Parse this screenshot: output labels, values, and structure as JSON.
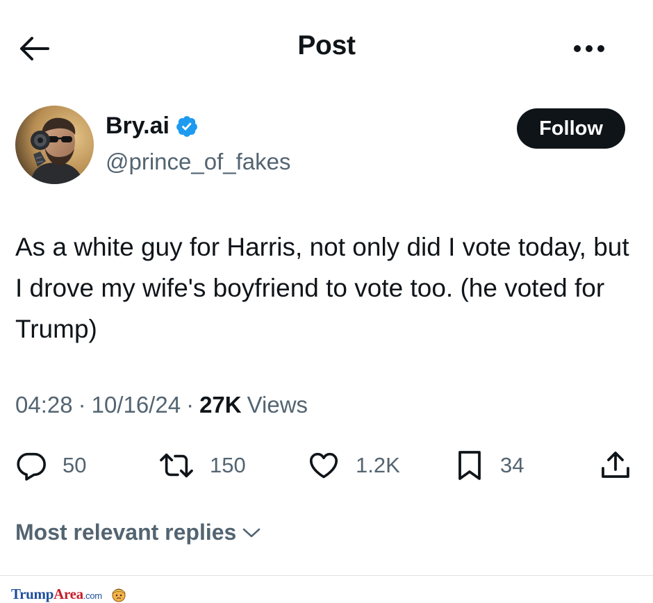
{
  "header": {
    "title": "Post",
    "back_icon": "arrow-left-icon",
    "more_icon": "more-horizontal-icon"
  },
  "author": {
    "display_name": "Bry.ai",
    "handle": "@prince_of_fakes",
    "verified_icon": "verified-badge-icon",
    "follow_label": "Follow"
  },
  "tweet": {
    "text": "As a white guy for Harris, not only did I vote today, but I drove my wife's boyfriend to vote too.  (he voted for Trump)"
  },
  "meta": {
    "time": "04:28",
    "separator": "·",
    "date": "10/16/24",
    "views_count": "27K",
    "views_label": "Views"
  },
  "actions": {
    "replies": "50",
    "reposts": "150",
    "likes": "1.2K",
    "bookmarks": "34"
  },
  "replies_sort": {
    "label": "Most relevant replies"
  },
  "watermark": {
    "part1": "Trump",
    "part2": "Area",
    "suffix": ".com"
  },
  "colors": {
    "text_primary": "#0f1419",
    "text_secondary": "#536471",
    "verified_blue": "#1d9bf0",
    "follow_bg": "#0f1419"
  }
}
